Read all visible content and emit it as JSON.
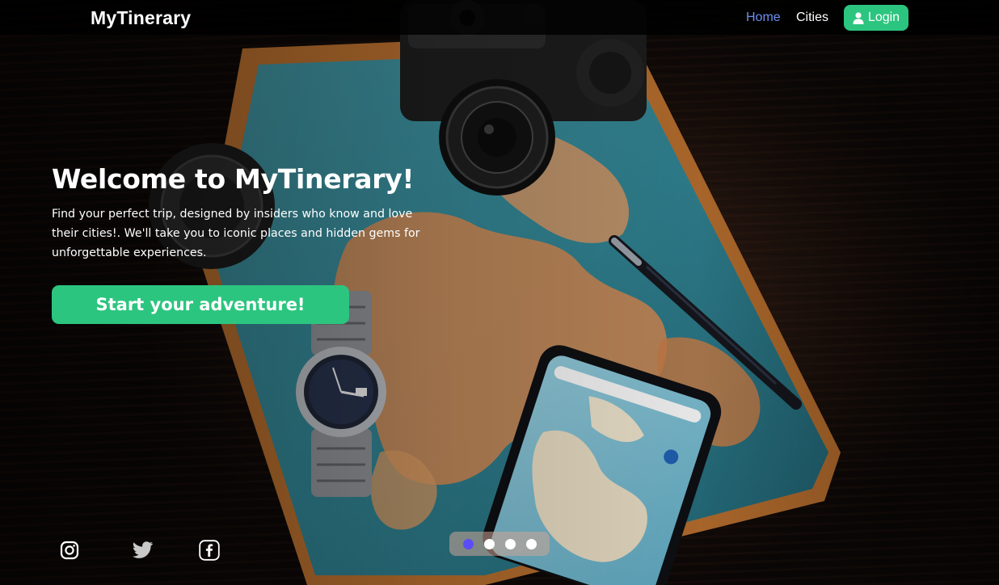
{
  "navbar": {
    "brand": "MyTinerary",
    "links": [
      {
        "label": "Home",
        "active": true
      },
      {
        "label": "Cities",
        "active": false
      }
    ],
    "login_label": "Login",
    "login_icon": "user-icon"
  },
  "hero": {
    "title": "Welcome to MyTinerary!",
    "description": "Find your perfect trip, designed by insiders who know and love their cities!. We'll take you to iconic places and hidden gems for unforgettable experiences.",
    "cta_label": "Start your adventure!"
  },
  "social": [
    {
      "icon": "instagram-icon"
    },
    {
      "icon": "twitter-icon"
    },
    {
      "icon": "facebook-icon"
    }
  ],
  "carousel": {
    "slide_count": 4,
    "active_index": 0
  },
  "colors": {
    "accent_green": "#2cc57f",
    "nav_active": "#6f8ff2",
    "indicator_active": "#5b4df5",
    "navbar_bg": "#000000"
  }
}
